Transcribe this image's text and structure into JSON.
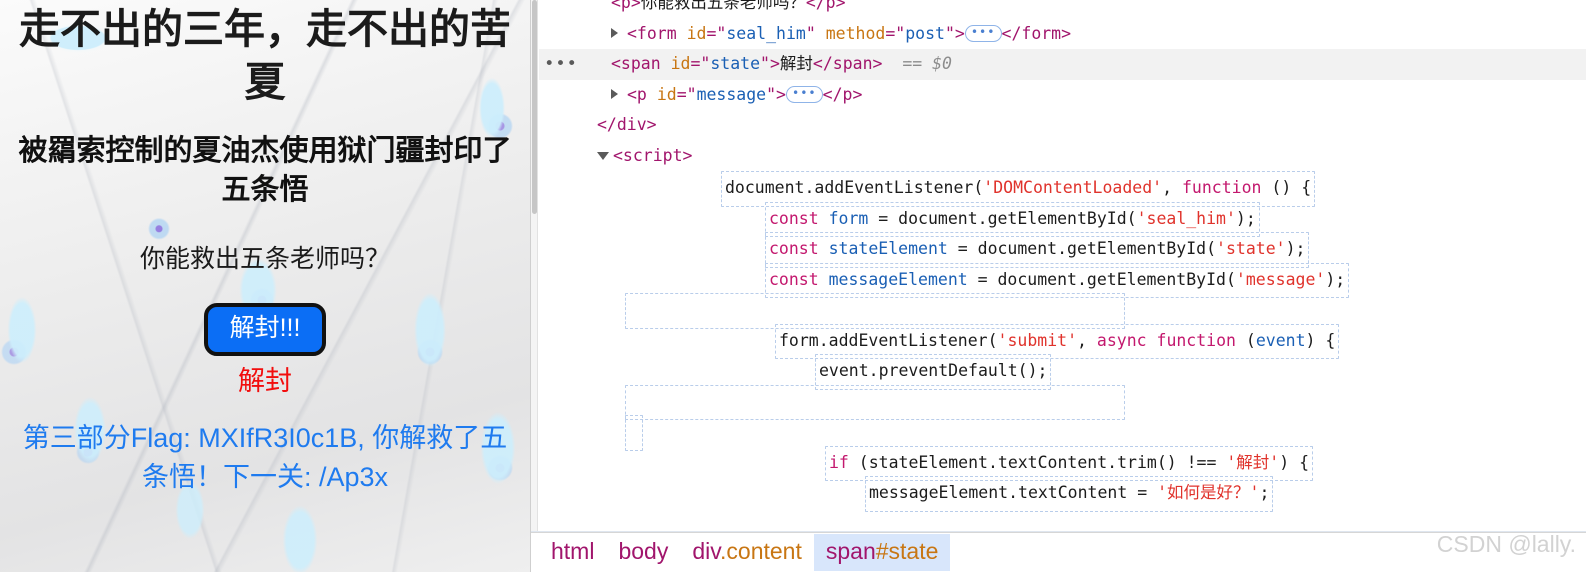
{
  "page": {
    "h1": "走不出的三年，走不出的苦夏",
    "h2": "被羂索控制的夏油杰使用狱门疆封印了五条悟",
    "question": "你能救出五条老师吗？",
    "button_label": "解封!!!",
    "state_text": "解封",
    "message_text": "第三部分Flag: MXIfR3I0c1B, 你解救了五条悟！下一关: /Ap3x",
    "colors": {
      "button_bg": "#0b6ef5",
      "button_text": "#ffffff",
      "button_border": "#111111",
      "state_color": "#f20d0d",
      "message_color": "#1f7bef"
    }
  },
  "devtools": {
    "dom_rows": [
      {
        "id": "row-p-question",
        "twisty": "none",
        "gutter": "",
        "selected": false,
        "segments": [
          {
            "t": "tag",
            "v": "<p>"
          },
          {
            "t": "txt",
            "v": "你能救出五条老师吗？"
          },
          {
            "t": "tag",
            "v": "</p>"
          }
        ]
      },
      {
        "id": "row-form",
        "twisty": "closed",
        "gutter": "",
        "selected": false,
        "segments": [
          {
            "t": "tag",
            "v": "<form "
          },
          {
            "t": "attr",
            "v": "id"
          },
          {
            "t": "tag",
            "v": "=\""
          },
          {
            "t": "val",
            "v": "seal_him"
          },
          {
            "t": "tag",
            "v": "\" "
          },
          {
            "t": "attr",
            "v": "method"
          },
          {
            "t": "tag",
            "v": "=\""
          },
          {
            "t": "val",
            "v": "post"
          },
          {
            "t": "tag",
            "v": "\">"
          },
          {
            "t": "badge",
            "v": "•••"
          },
          {
            "t": "tag",
            "v": "</form>"
          }
        ]
      },
      {
        "id": "row-span-state",
        "twisty": "none",
        "gutter": "•••",
        "selected": true,
        "segments": [
          {
            "t": "tag",
            "v": "<span "
          },
          {
            "t": "attr",
            "v": "id"
          },
          {
            "t": "tag",
            "v": "=\""
          },
          {
            "t": "val",
            "v": "state"
          },
          {
            "t": "tag",
            "v": "\">"
          },
          {
            "t": "txt",
            "v": "解封"
          },
          {
            "t": "tag",
            "v": "</span>"
          },
          {
            "t": "eq",
            "v": "  == "
          },
          {
            "t": "dollar",
            "v": "$0"
          }
        ]
      },
      {
        "id": "row-p-message",
        "twisty": "closed",
        "gutter": "",
        "selected": false,
        "segments": [
          {
            "t": "tag",
            "v": "<p "
          },
          {
            "t": "attr",
            "v": "id"
          },
          {
            "t": "tag",
            "v": "=\""
          },
          {
            "t": "val",
            "v": "message"
          },
          {
            "t": "tag",
            "v": "\">"
          },
          {
            "t": "badge",
            "v": "•••"
          },
          {
            "t": "tag",
            "v": "</p>"
          }
        ]
      },
      {
        "id": "row-div-close",
        "twisty": "none",
        "gutter": "",
        "selected": false,
        "indent": "close",
        "segments": [
          {
            "t": "tag",
            "v": "</div>"
          }
        ]
      },
      {
        "id": "row-script",
        "twisty": "open",
        "gutter": "",
        "selected": false,
        "indent": "close",
        "segments": [
          {
            "t": "tag",
            "v": "<script>"
          }
        ]
      }
    ],
    "script_lines": [
      {
        "id": "js-line-domcontentloaded",
        "indent": 96,
        "segments": [
          {
            "t": "plain",
            "v": "document.addEventListener("
          },
          {
            "t": "str",
            "v": "'DOMContentLoaded'"
          },
          {
            "t": "plain",
            "v": ", "
          },
          {
            "t": "kw",
            "v": "function"
          },
          {
            "t": "plain",
            "v": " () {"
          }
        ]
      },
      {
        "id": "js-line-const-form",
        "indent": 140,
        "segments": [
          {
            "t": "kw",
            "v": "const"
          },
          {
            "t": "plain",
            "v": " "
          },
          {
            "t": "ident",
            "v": "form"
          },
          {
            "t": "plain",
            "v": " = document.getElementById("
          },
          {
            "t": "str",
            "v": "'seal_him'"
          },
          {
            "t": "plain",
            "v": ");"
          }
        ]
      },
      {
        "id": "js-line-const-stateelement",
        "indent": 140,
        "segments": [
          {
            "t": "kw",
            "v": "const"
          },
          {
            "t": "plain",
            "v": " "
          },
          {
            "t": "ident",
            "v": "stateElement"
          },
          {
            "t": "plain",
            "v": " = document.getElementById("
          },
          {
            "t": "str",
            "v": "'state'"
          },
          {
            "t": "plain",
            "v": ");"
          }
        ]
      },
      {
        "id": "js-line-const-messageelement",
        "indent": 140,
        "segments": [
          {
            "t": "kw",
            "v": "const"
          },
          {
            "t": "plain",
            "v": " "
          },
          {
            "t": "ident",
            "v": "messageElement"
          },
          {
            "t": "plain",
            "v": " = document.getElementById("
          },
          {
            "t": "str",
            "v": "'message'"
          },
          {
            "t": "plain",
            "v": ");"
          }
        ]
      },
      {
        "id": "js-line-blank-1",
        "indent": 0,
        "blank": true,
        "segments": []
      },
      {
        "id": "js-line-form-submit",
        "indent": 150,
        "segments": [
          {
            "t": "plain",
            "v": "form.addEventListener("
          },
          {
            "t": "str",
            "v": "'submit'"
          },
          {
            "t": "plain",
            "v": ", "
          },
          {
            "t": "kw",
            "v": "async function"
          },
          {
            "t": "plain",
            "v": " ("
          },
          {
            "t": "ident",
            "v": "event"
          },
          {
            "t": "plain",
            "v": ") {"
          }
        ]
      },
      {
        "id": "js-line-preventdefault",
        "indent": 190,
        "segments": [
          {
            "t": "plain",
            "v": "event.preventDefault();"
          }
        ]
      },
      {
        "id": "js-line-blank-2",
        "indent": 0,
        "blank": true,
        "segments": []
      },
      {
        "id": "js-line-blank-3",
        "indent": 0,
        "tiny": true,
        "segments": []
      },
      {
        "id": "js-line-if-state",
        "indent": 200,
        "segments": [
          {
            "t": "kw",
            "v": "if"
          },
          {
            "t": "plain",
            "v": " (stateElement.textContent.trim() !== "
          },
          {
            "t": "str",
            "v": "'解封'"
          },
          {
            "t": "plain",
            "v": ") {"
          }
        ]
      },
      {
        "id": "js-line-message-assign",
        "indent": 240,
        "segments": [
          {
            "t": "plain",
            "v": "messageElement.textContent = "
          },
          {
            "t": "str",
            "v": "'如何是好？'"
          },
          {
            "t": "plain",
            "v": ";"
          }
        ]
      }
    ],
    "breadcrumb": [
      {
        "tag": "html",
        "cls": "",
        "active": false
      },
      {
        "tag": "body",
        "cls": "",
        "active": false
      },
      {
        "tag": "div",
        "cls": ".content",
        "active": false
      },
      {
        "tag": "span",
        "cls": "#state",
        "active": true
      }
    ]
  },
  "watermark": "CSDN @lally."
}
